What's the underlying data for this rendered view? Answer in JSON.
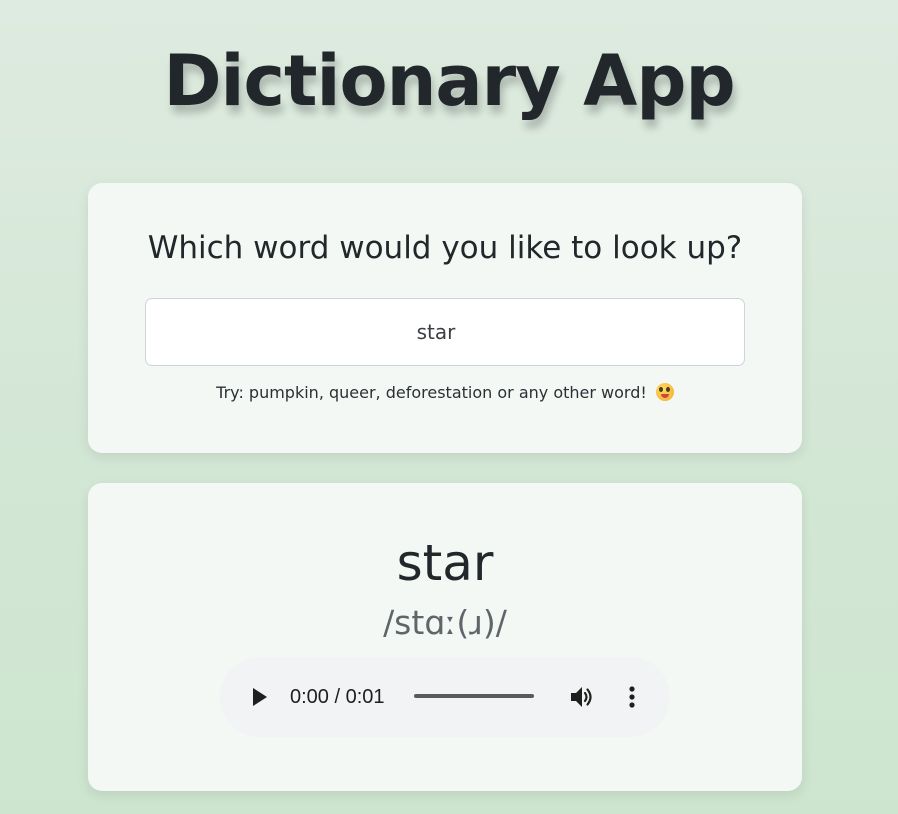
{
  "app": {
    "title": "Dictionary App"
  },
  "search": {
    "heading": "Which word would you like to look up?",
    "value": "star",
    "hint": "Try: pumpkin, queer, deforestation or any other word!",
    "hint_emoji": "zany-face-emoji"
  },
  "result": {
    "word": "star",
    "phonetic": "/stɑː(ɹ)/",
    "audio": {
      "time": "0:00 / 0:01",
      "progress": 0
    }
  },
  "colors": {
    "background": "#d4e7d6",
    "card": "#f4f8f4",
    "text": "#22272b",
    "phonetic": "#5f6568",
    "player": "#f1f3f4"
  }
}
